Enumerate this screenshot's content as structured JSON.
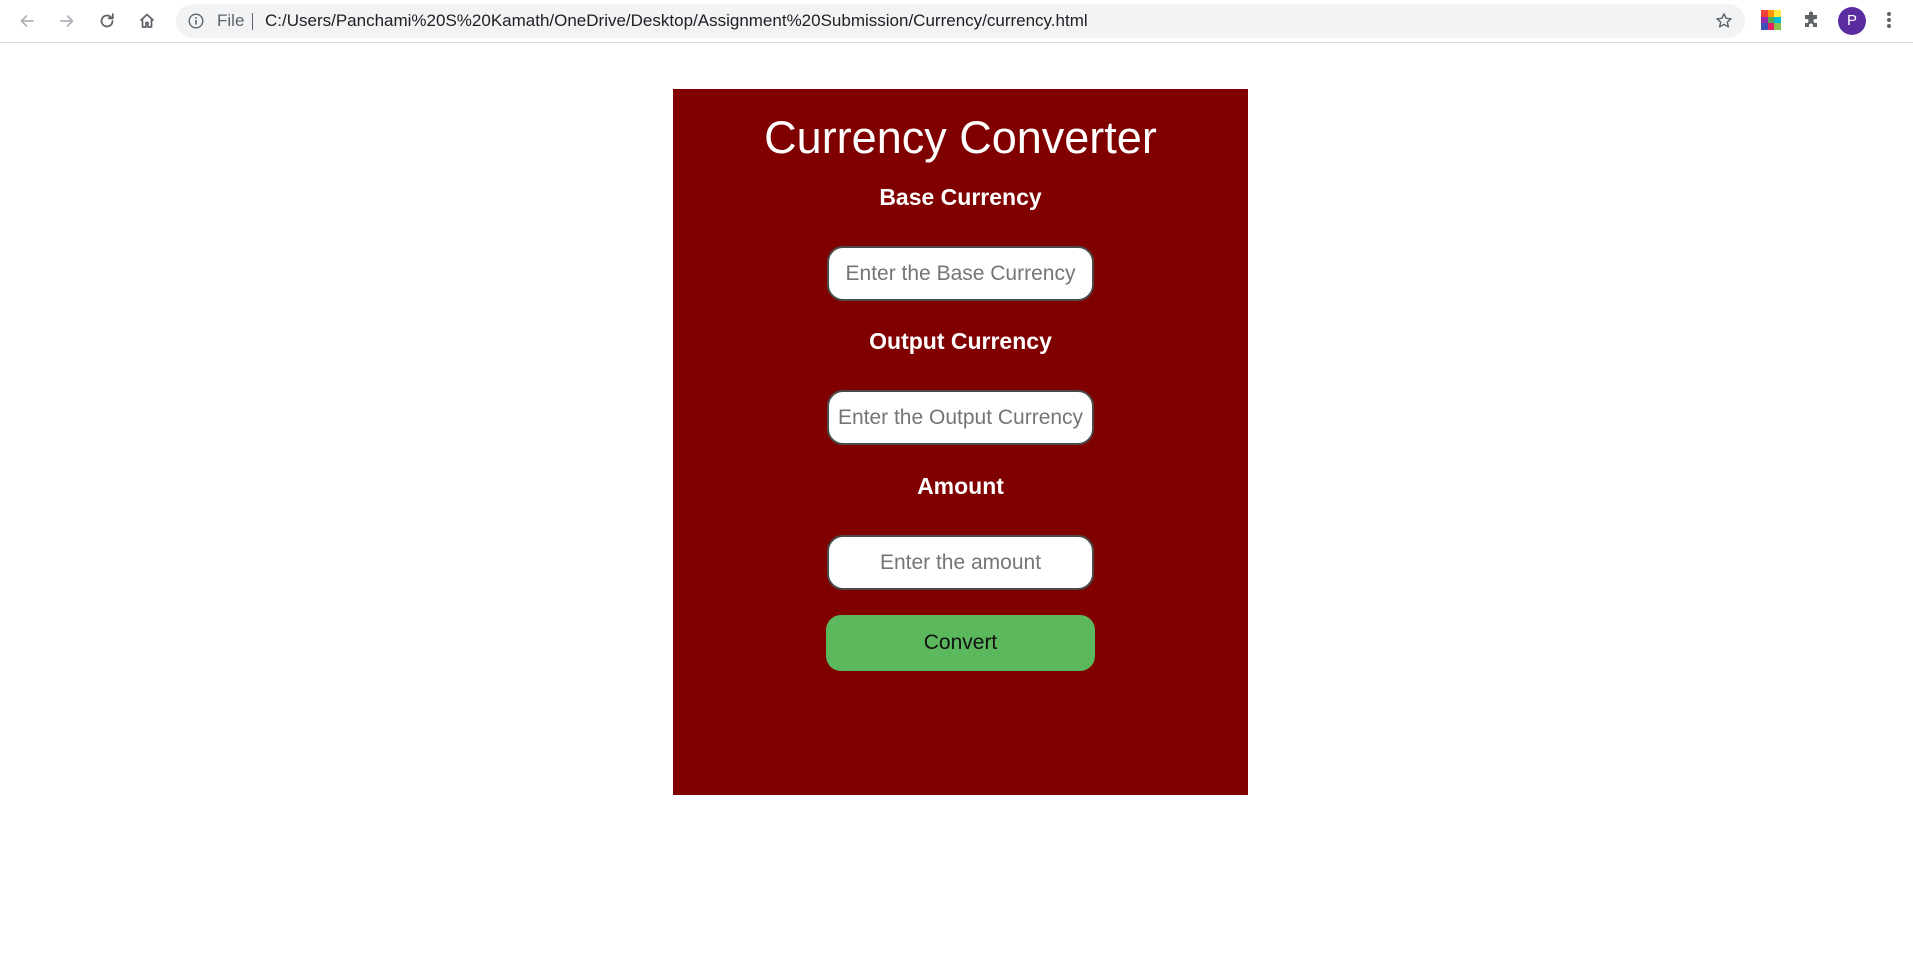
{
  "browser": {
    "scheme_label": "File",
    "url": "C:/Users/Panchami%20S%20Kamath/OneDrive/Desktop/Assignment%20Submission/Currency/currency.html",
    "profile_initial": "P",
    "icons": [
      "back-icon",
      "forward-icon",
      "reload-icon",
      "home-icon",
      "info-icon",
      "star-icon",
      "extension-icon",
      "puzzle-icon",
      "kebab-menu-icon"
    ]
  },
  "app": {
    "title": "Currency Converter",
    "base_label": "Base Currency",
    "base_placeholder": "Enter the Base Currency",
    "output_label": "Output Currency",
    "output_placeholder": "Enter the Output Currency",
    "amount_label": "Amount",
    "amount_placeholder": "Enter the amount",
    "convert_label": "Convert"
  },
  "colors": {
    "card_background": "#800000",
    "convert_button": "#5cb85c",
    "text_on_card": "#ffffff"
  }
}
